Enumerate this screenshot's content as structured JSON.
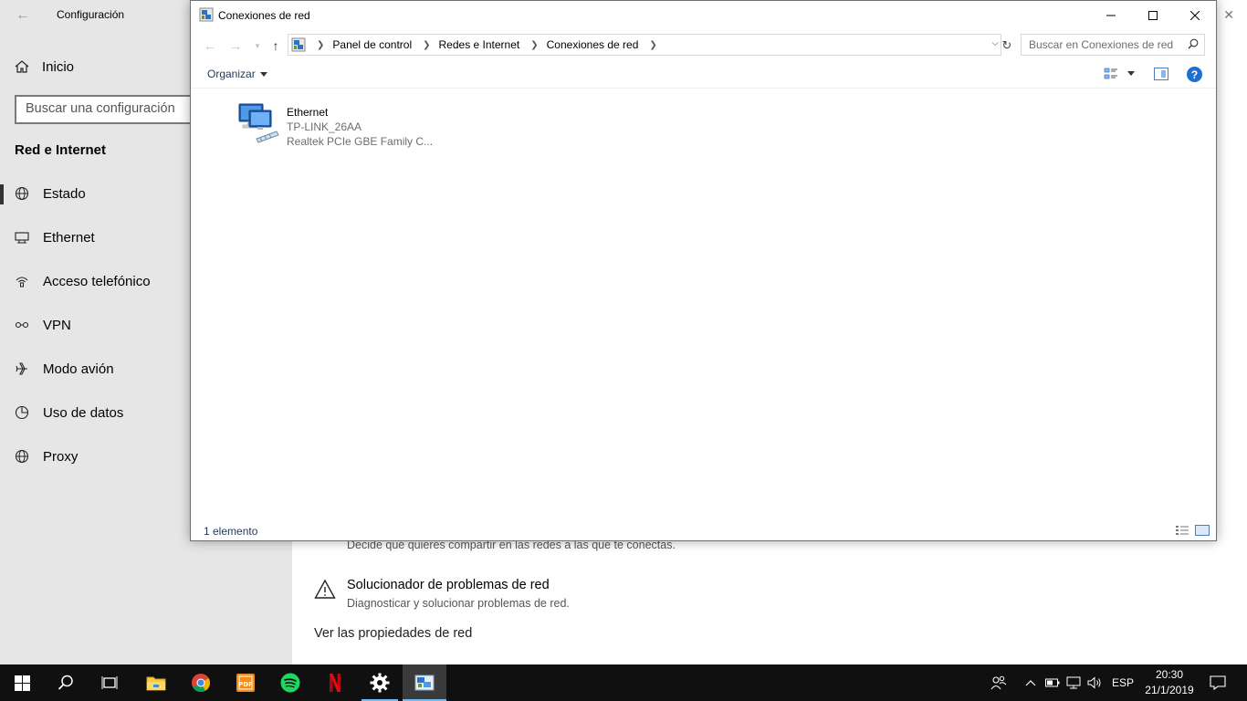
{
  "settings": {
    "title": "Configuración",
    "home": "Inicio",
    "search_placeholder": "Buscar una configuración",
    "section": "Red e Internet",
    "nav": [
      {
        "label": "Estado",
        "icon": "globe-icon"
      },
      {
        "label": "Ethernet",
        "icon": "ethernet-icon"
      },
      {
        "label": "Acceso telefónico",
        "icon": "dialup-icon"
      },
      {
        "label": "VPN",
        "icon": "vpn-icon"
      },
      {
        "label": "Modo avión",
        "icon": "airplane-icon"
      },
      {
        "label": "Uso de datos",
        "icon": "data-usage-icon"
      },
      {
        "label": "Proxy",
        "icon": "globe-icon"
      }
    ],
    "sharing_desc": "Decide qué quieres compartir en las redes a las que te conectas.",
    "troubleshooter_title": "Solucionador de problemas de red",
    "troubleshooter_desc": "Diagnosticar y solucionar problemas de red.",
    "properties_link": "Ver las propiedades de red"
  },
  "explorer": {
    "title": "Conexiones de red",
    "breadcrumb": [
      "Panel de control",
      "Redes e Internet",
      "Conexiones de red"
    ],
    "search_placeholder": "Buscar en Conexiones de red",
    "organize": "Organizar",
    "help": "?",
    "items": [
      {
        "name": "Ethernet",
        "network": "TP-LINK_26AA",
        "device": "Realtek PCIe GBE Family C..."
      }
    ],
    "status": "1 elemento"
  },
  "taskbar": {
    "language": "ESP",
    "time": "20:30",
    "date": "21/1/2019",
    "apps": [
      "file-explorer-icon",
      "chrome-icon",
      "pdf-icon",
      "spotify-icon",
      "netflix-icon",
      "settings-gear-icon",
      "network-connections-icon"
    ]
  },
  "colors": {
    "accent": "#76b9ed",
    "link": "#1e395b",
    "taskbar": "#101010"
  }
}
